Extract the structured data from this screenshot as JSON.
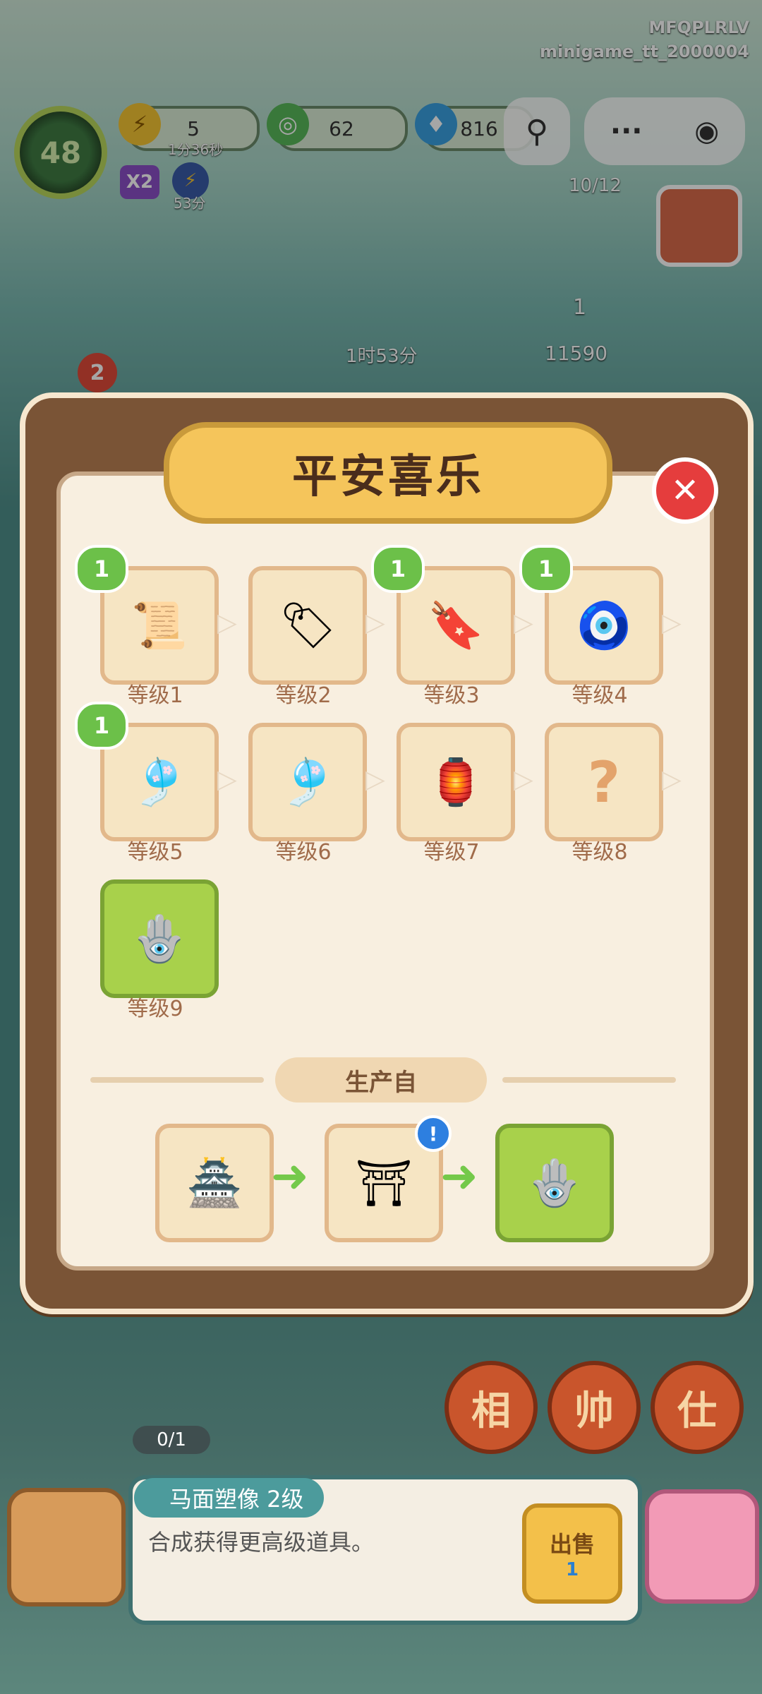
{
  "header": {
    "account_id": "MFQPLRLV",
    "game_id": "minigame_tt_2000004",
    "level": "48",
    "energy": {
      "value": "5",
      "timer": "1分36秒"
    },
    "coins": {
      "value": "62"
    },
    "gems": {
      "value": "816"
    },
    "multiplier": "X2",
    "buff_timer": "53分"
  },
  "scene": {
    "customer_count": "10/12",
    "order_count": "1",
    "order_reward": "11590",
    "order_timer": "1时53分",
    "left_badge": "2"
  },
  "modal": {
    "title": "平安喜乐",
    "close_label": "✕",
    "levels": [
      {
        "label": "等级1",
        "icon": "paper-talisman-icon",
        "badge": "1"
      },
      {
        "label": "等级2",
        "icon": "wooden-tag-icon",
        "badge": ""
      },
      {
        "label": "等级3",
        "icon": "wooden-amulet-icon",
        "badge": "1"
      },
      {
        "label": "等级4",
        "icon": "tasseled-amulet-icon",
        "badge": "1"
      },
      {
        "label": "等级5",
        "icon": "teal-tassel-amulet-icon",
        "badge": "1"
      },
      {
        "label": "等级6",
        "icon": "blue-tassel-amulet-icon",
        "badge": ""
      },
      {
        "label": "等级7",
        "icon": "golden-purple-amulet-icon",
        "badge": ""
      },
      {
        "label": "等级8",
        "icon": "unknown-question-icon",
        "badge": ""
      },
      {
        "label": "等级9",
        "icon": "gold-jade-amulet-icon",
        "badge": ""
      }
    ],
    "unknown_glyph": "?",
    "section_title": "生产自",
    "production": [
      {
        "icon": "temple-building-icon"
      },
      {
        "icon": "shrine-stall-icon",
        "alert": "!"
      },
      {
        "icon": "gold-jade-amulet-icon"
      }
    ]
  },
  "bottom": {
    "counter": "0/1",
    "item_name": "马面塑像 2级",
    "item_desc": "合成获得更高级道具。",
    "sell_label": "出售",
    "sell_price": "1",
    "board_chars": [
      "相",
      "帅",
      "仕"
    ]
  },
  "colors": {
    "panel_brown": "#7a5436",
    "panel_cream": "#f8efe0",
    "title_gold": "#f5c55b",
    "close_red": "#e53d3d",
    "badge_green": "#6cc049",
    "label_brown": "#a06b4a"
  }
}
